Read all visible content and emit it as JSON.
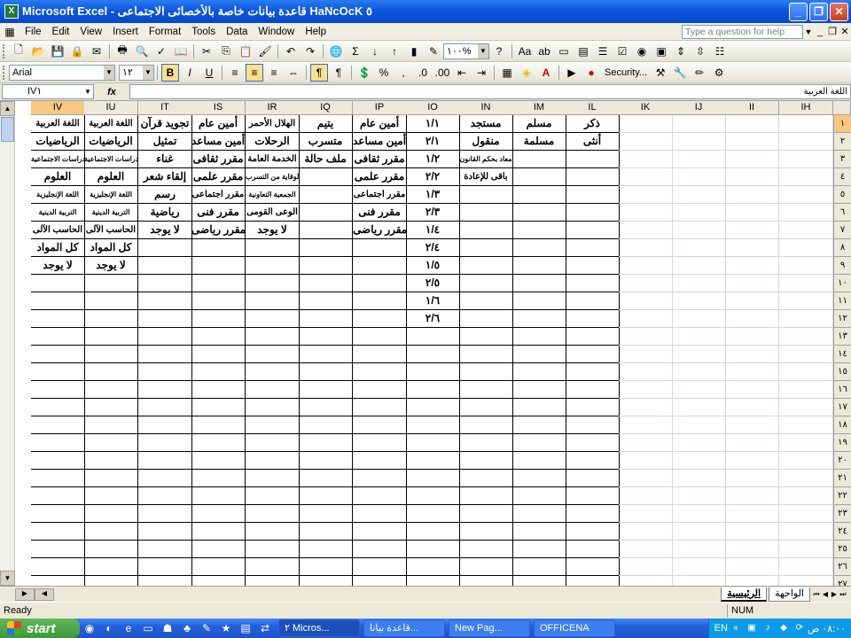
{
  "window": {
    "title": "Microsoft Excel - قاعدة بيانات خاصة بالأخصائى الاجتماعى HaNcOcK ٥",
    "app_icon": "excel-icon"
  },
  "menu": {
    "items": [
      "File",
      "Edit",
      "View",
      "Insert",
      "Format",
      "Tools",
      "Data",
      "Window",
      "Help"
    ],
    "question_placeholder": "Type a question for help"
  },
  "toolbar": {
    "zoom": "١٠٠%",
    "security_label": "Security..."
  },
  "format": {
    "font": "Arial",
    "size": "١٢",
    "percent": "%"
  },
  "namebox": {
    "ref": "IV١"
  },
  "formula": {
    "fx": "fx",
    "content": "اللغة العربية"
  },
  "columns": [
    "IV",
    "IU",
    "IT",
    "IS",
    "IR",
    "IQ",
    "IP",
    "IO",
    "IN",
    "IM",
    "IL",
    "IK",
    "IJ",
    "II",
    "IH"
  ],
  "rows": [
    "١",
    "٢",
    "٣",
    "٤",
    "٥",
    "٦",
    "٧",
    "٨",
    "٩",
    "١٠",
    "١١",
    "١٢",
    "١٣",
    "١٤",
    "١٥",
    "١٦",
    "١٧",
    "١٨",
    "١٩",
    "٢٠",
    "٢١",
    "٢٢",
    "٢٣",
    "٢٤",
    "٢٥",
    "٢٦",
    "٢٧"
  ],
  "cells": {
    "IV": [
      "اللغة العربية",
      "الرياضيات",
      "الدراسات الاجتماعية",
      "العلوم",
      "اللغة الإنجليزية",
      "التربية الدينية",
      "الحاسب الآلى",
      "كل المواد",
      "لا يوجد"
    ],
    "IU": [
      "اللغة العربية",
      "الرياضيات",
      "الدراسات الاجتماعية",
      "العلوم",
      "اللغة الإنجليزية",
      "التربية الدينية",
      "الحاسب الآلى",
      "كل المواد",
      "لا يوجد"
    ],
    "IT": [
      "تجويد قرآن",
      "تمثيل",
      "غناء",
      "إلقاء شعر",
      "رسم",
      "رياضية",
      "لا يوجد"
    ],
    "IS": [
      "أمين عام",
      "أمين مساعد",
      "مقرر ثقافى",
      "مقرر علمى",
      "مقرر اجتماعى",
      "مقرر فنى",
      "مقرر رياضى"
    ],
    "IR": [
      "الهلال الأحمر",
      "الرحلات",
      "الخدمة العامة",
      "الوقاية من التسرب",
      "الجمعية التعاونية",
      "الوعى القومى",
      "لا يوجد"
    ],
    "IQ": [
      "يتيم",
      "متسرب",
      "ملف حالة"
    ],
    "IP": [
      "أمين عام",
      "أمين مساعد",
      "مقرر ثقافى",
      "مقرر علمى",
      "مقرر اجتماعى",
      "مقرر فنى",
      "مقرر رياضى"
    ],
    "IO": [
      "١/١",
      "٢/١",
      "١/٢",
      "٢/٢",
      "١/٣",
      "٢/٣",
      "١/٤",
      "٢/٤",
      "١/٥",
      "٢/٥",
      "١/٦",
      "٢/٦"
    ],
    "IN": [
      "مستجد",
      "منقول",
      "معاد بحكم القانون",
      "باقى للإعادة"
    ],
    "IM": [
      "مسلم",
      "مسلمة"
    ],
    "IL": [
      "ذكر",
      "أنثى"
    ]
  },
  "sheets": [
    "الرئيسية",
    "الواجهة"
  ],
  "status": {
    "ready": "Ready",
    "num": "NUM"
  },
  "taskbar": {
    "start": "start",
    "buttons": [
      "٢ Micros...",
      "قاعدة بيانا...",
      "New Pag...",
      "OFFICENA"
    ],
    "lang": "EN",
    "clock": "٠٨:٠٠ ص"
  }
}
